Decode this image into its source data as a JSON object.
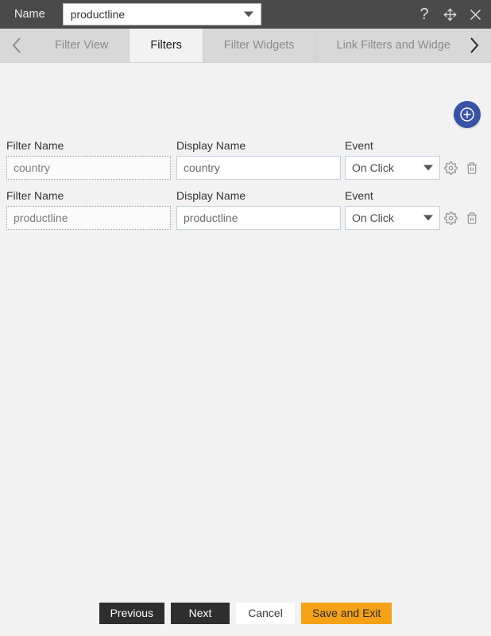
{
  "titlebar": {
    "label": "Name",
    "name_value": "productline",
    "help_icon": "question-mark-icon",
    "move_icon": "move-arrows-icon",
    "close_icon": "close-icon"
  },
  "tabbar": {
    "prev_arrow": "chevron-left-icon",
    "next_arrow": "chevron-right-icon",
    "tabs": [
      {
        "label": "Filter View",
        "active": false
      },
      {
        "label": "Filters",
        "active": true
      },
      {
        "label": "Filter Widgets",
        "active": false
      },
      {
        "label": "Link Filters and Widge",
        "active": false
      }
    ]
  },
  "content": {
    "add_button": "add-circle-icon",
    "labels": {
      "filter_name": "Filter Name",
      "display_name": "Display Name",
      "event": "Event"
    },
    "rows": [
      {
        "filter_name": "country",
        "display_name": "country",
        "event": "On Click",
        "settings_icon": "gear-icon",
        "delete_icon": "trash-icon"
      },
      {
        "filter_name": "productline",
        "display_name": "productline",
        "event": "On Click",
        "settings_icon": "gear-icon",
        "delete_icon": "trash-icon"
      }
    ]
  },
  "footer": {
    "previous": "Previous",
    "next": "Next",
    "cancel": "Cancel",
    "save_and_exit": "Save and Exit"
  },
  "colors": {
    "titlebar_bg": "#4a4a4a",
    "tab_inactive_bg": "#d8d8d8",
    "tab_active_bg": "#f2f2f2",
    "content_bg": "#f2f2f2",
    "fab_blue": "#3852a4",
    "accent_orange": "#f5a218",
    "button_dark": "#2e2e2e"
  }
}
